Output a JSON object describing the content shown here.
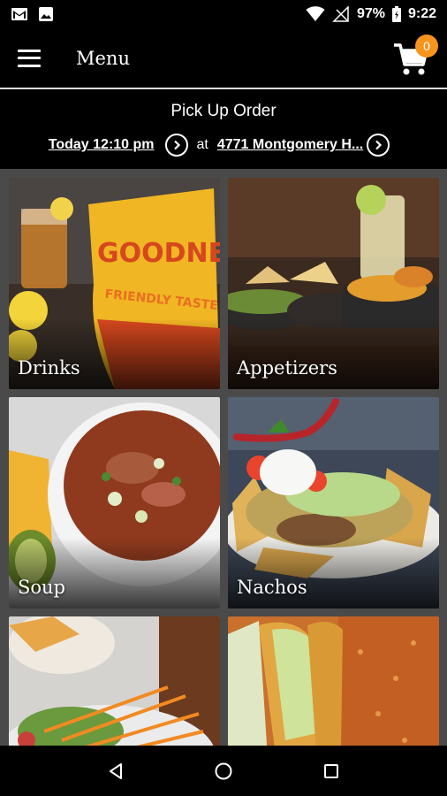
{
  "status_bar": {
    "battery": "97%",
    "time": "9:22",
    "icons": [
      "gmail-icon",
      "image-icon",
      "wifi-icon",
      "signal-icon",
      "battery-icon"
    ]
  },
  "app_bar": {
    "title": "Menu",
    "cart_count": "0",
    "badge_color": "#f7941d"
  },
  "order": {
    "type": "Pick Up Order",
    "time": "Today 12:10 pm",
    "at": "at",
    "location": "4771 Montgomery H..."
  },
  "categories": [
    {
      "label": "Drinks"
    },
    {
      "label": "Appetizers"
    },
    {
      "label": "Soup"
    },
    {
      "label": "Nachos"
    },
    {
      "label": ""
    },
    {
      "label": ""
    }
  ]
}
